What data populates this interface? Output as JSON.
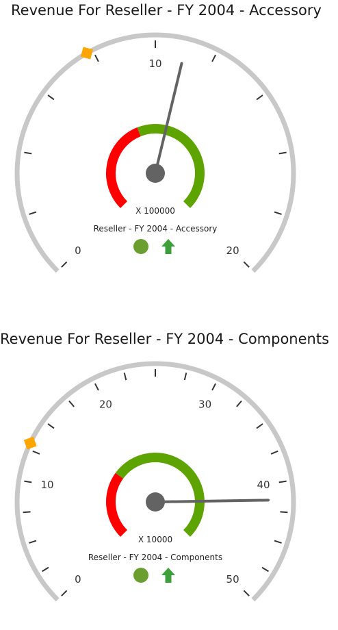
{
  "colors": {
    "scale": "#c8c8c8",
    "ticks": "#333333",
    "needle": "#636363",
    "pivot": "#636363",
    "marker": "#ffa500",
    "range_bad": "#ff0000",
    "range_good": "#5ea400",
    "status_circle": "#6a9e2e",
    "status_arrow": "#3ea03a"
  },
  "chart_data": [
    {
      "type": "gauge",
      "title": "Revenue For Reseller - FY 2004 - Accessory",
      "scale": {
        "min": 0,
        "max": 20,
        "major_interval": 2
      },
      "tick_labels": [
        "0",
        "10",
        "20"
      ],
      "tick_label_values": [
        0,
        10,
        20
      ],
      "multiplier_label": "X 100000",
      "subtitle": "Reseller - FY 2004 - Accessory",
      "needle_value": 11,
      "marker_value": 7.8,
      "inner_range": {
        "bad_fraction": 0.42
      },
      "status_indicator": "green-circle",
      "trend_indicator": "up-arrow"
    },
    {
      "type": "gauge",
      "title": "Revenue For Reseller - FY 2004 - Components",
      "scale": {
        "min": 0,
        "max": 50,
        "major_interval": 2.5
      },
      "tick_labels": [
        "0",
        "10",
        "20",
        "30",
        "40",
        "50"
      ],
      "tick_label_values": [
        0,
        10,
        20,
        30,
        40,
        50
      ],
      "multiplier_label": "X 10000",
      "subtitle": "Reseller - FY 2004 - Components",
      "needle_value": 41.5,
      "marker_value": 13,
      "inner_range": {
        "bad_fraction": 0.3
      },
      "status_indicator": "green-circle",
      "trend_indicator": "up-arrow"
    }
  ]
}
